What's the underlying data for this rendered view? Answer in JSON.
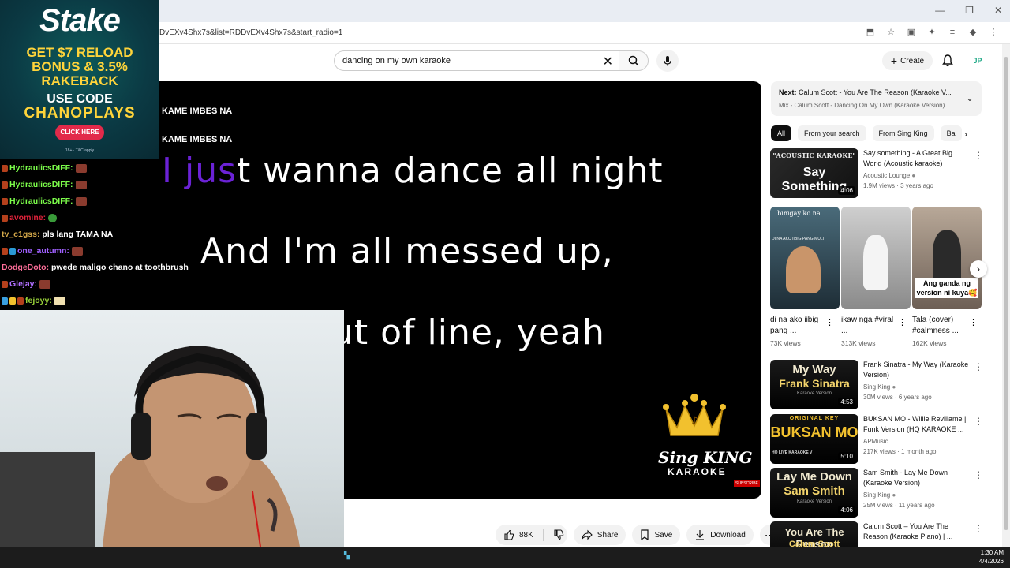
{
  "browser": {
    "url": "DvEXv4Shx7s&list=RDDvEXv4Shx7s&start_radio=1",
    "window_controls": [
      "—",
      "❐",
      "✕"
    ]
  },
  "youtube": {
    "search_query": "dancing on my own karaoke",
    "create_label": "Create",
    "avatar_initials": "JP"
  },
  "player": {
    "small_lines": [
      "KAME IMBES NA",
      "KAME IMBES NA"
    ],
    "lyrics": [
      {
        "highlight": "I jus",
        "rest": "t wanna dance all night"
      },
      {
        "highlight": "",
        "rest": "And I'm all messed up,"
      },
      {
        "highlight": "",
        "rest": "ut of line, yeah"
      }
    ],
    "brand_title": "Sing KING",
    "brand_sub": "KARAOKE",
    "brand_subscribe": "SUBSCRIBE"
  },
  "actions": {
    "likes": "88K",
    "share": "Share",
    "save": "Save",
    "download": "Download"
  },
  "next": {
    "label": "Next:",
    "title": "Calum Scott - You Are The Reason (Karaoke V...",
    "mix": "Mix - Calum Scott - Dancing On My Own (Karaoke Version)"
  },
  "chips": [
    "All",
    "From your search",
    "From Sing King",
    "Ba"
  ],
  "recommendations": [
    {
      "title": "Say something - A Great Big World (Acoustic karaoke)",
      "channel": "Acoustic Lounge",
      "meta": "1.9M views · 3 years ago",
      "duration": "4:06",
      "thumb_text": "Say Something",
      "thumb_top": "\"ACOUSTIC KARAOKE\""
    },
    {
      "title": "Frank Sinatra - My Way (Karaoke Version)",
      "channel": "Sing King",
      "meta": "30M views · 6 years ago",
      "duration": "4:53",
      "thumb_text": "My Way",
      "thumb_text2": "Frank Sinatra",
      "thumb_small": "Karaoke Version"
    },
    {
      "title": "BUKSAN MO - Willie Revillame | Funk Version (HQ KARAOKE ...",
      "channel": "APMusic",
      "meta": "217K views · 1 month ago",
      "duration": "5:10",
      "thumb_text": "BUKSAN MO",
      "thumb_top": "ORIGINAL KEY",
      "thumb_small": "HQ LIVE KARAOKE V"
    },
    {
      "title": "Sam Smith - Lay Me Down (Karaoke Version)",
      "channel": "Sing King",
      "meta": "25M views · 11 years ago",
      "duration": "4:06",
      "thumb_text": "Lay Me Down",
      "thumb_text2": "Sam Smith",
      "thumb_small": "Karaoke Version"
    },
    {
      "title": "Calum Scott – You Are The Reason (Karaoke Piano) | ...",
      "channel": "",
      "meta": "",
      "duration": "",
      "thumb_text": "You Are The Reason",
      "thumb_text2": "Calum Scott"
    }
  ],
  "shorts": [
    {
      "title": "di na ako iibig pang ...",
      "views": "73K views",
      "overlay": "",
      "top_text": "Ibinigay ko na",
      "small": "DI NA AKO IIBIG PANG MULI"
    },
    {
      "title": "ikaw nga #viral ...",
      "views": "313K views",
      "overlay": ""
    },
    {
      "title": "Tala (cover) #calmness ...",
      "views": "162K views",
      "overlay": "Ang ganda ng version ni kuya🥰"
    }
  ],
  "taskbar": {
    "time": "1:30 AM",
    "date": "4/4/2026"
  },
  "stake_ad": {
    "logo": "Stake",
    "line1": "GET $7 RELOAD",
    "line2": "BONUS & 3.5%",
    "line3": "RAKEBACK",
    "code_label": "USE CODE",
    "code": "CHANOPLAYS",
    "cta": "CLICK HERE",
    "terms": "18+ · T&C apply"
  },
  "chat": [
    {
      "user": "HydraulicsDIFF:",
      "color": "#7cfc4a",
      "msg": "",
      "emote": true
    },
    {
      "user": "HydraulicsDIFF:",
      "color": "#7cfc4a",
      "msg": "",
      "emote": true
    },
    {
      "user": "HydraulicsDIFF:",
      "color": "#7cfc4a",
      "msg": "",
      "emote": true
    },
    {
      "user": "avomine:",
      "color": "#e0223a",
      "msg": "",
      "emote": true
    },
    {
      "user": "tv_c1gss:",
      "color": "#d4a84a",
      "msg": "pls lang TAMA NA",
      "emote": false
    },
    {
      "user": "one_autumn:",
      "color": "#a060ff",
      "msg": "",
      "emote": true
    },
    {
      "user": "DodgeDoto:",
      "color": "#ff6f9a",
      "msg": "pwede maligo chano at toothbrush",
      "emote": false
    },
    {
      "user": "Glejay:",
      "color": "#b070ff",
      "msg": "",
      "emote": true
    },
    {
      "user": "fejoyy:",
      "color": "#9ad33a",
      "msg": "",
      "emote": true
    }
  ],
  "colors": {
    "lyric_highlight": "#6b22d6",
    "stake_yellow": "#ffd43a",
    "stake_cta": "#e22a4a"
  }
}
